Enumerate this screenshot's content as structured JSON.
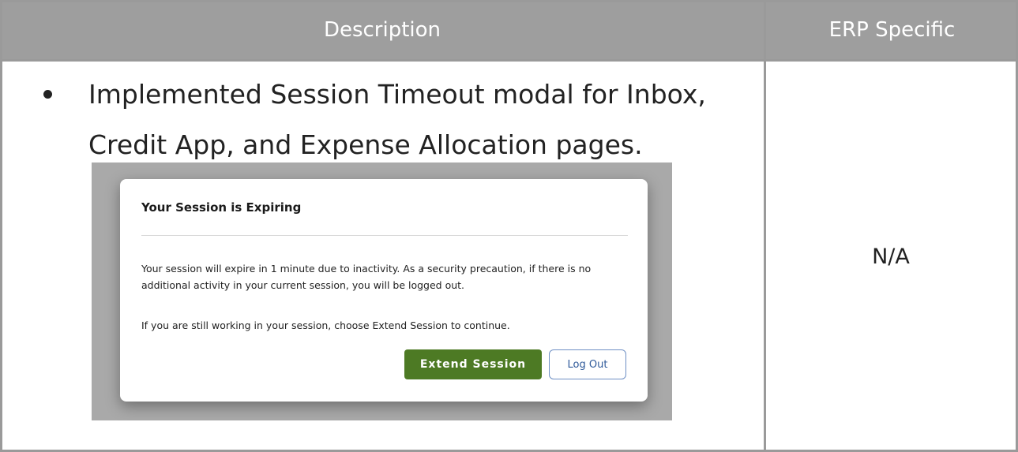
{
  "table": {
    "header": {
      "description": "Description",
      "erp_specific": "ERP Specific"
    },
    "row": {
      "bullet_text": "Implemented Session Timeout modal for Inbox, Credit App, and Expense Allocation pages.",
      "erp_value": "N/A"
    }
  },
  "modal": {
    "title": "Your Session is Expiring",
    "paragraph1": "Your session will expire in 1 minute due to inactivity. As a security precaution, if there is no additional activity in your current session, you will be logged out.",
    "paragraph2": "If you are still working in your session, choose Extend Session to continue.",
    "extend_label": "Extend Session",
    "logout_label": "Log Out"
  },
  "colors": {
    "header_bg": "#9e9e9e",
    "extend_button": "#4d7a24",
    "logout_border": "#6e8fc4"
  }
}
